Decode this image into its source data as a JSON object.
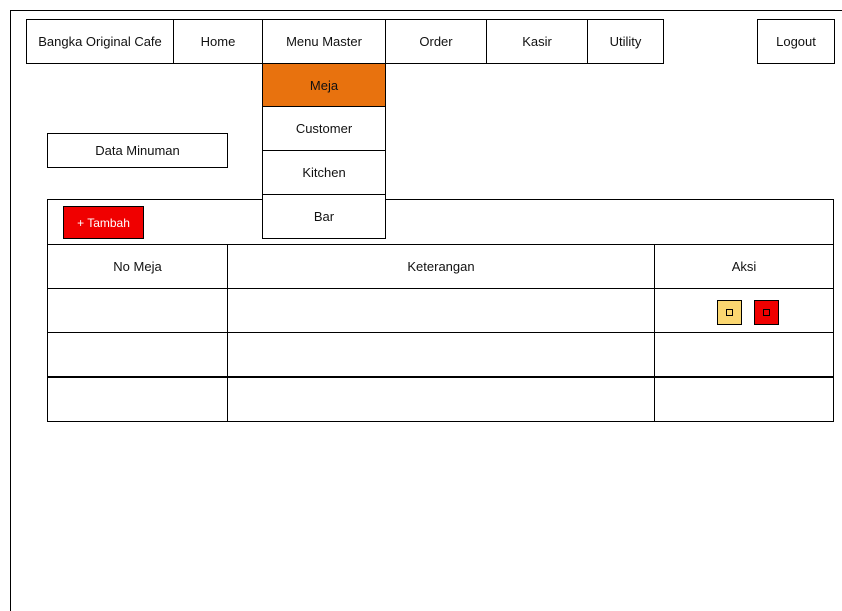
{
  "nav": {
    "brand": "Bangka Original Cafe",
    "items": [
      "Home",
      "Menu Master",
      "Order",
      "Kasir",
      "Utility"
    ],
    "logout": "Logout"
  },
  "dropdown": {
    "items": [
      "Meja",
      "Customer",
      "Kitchen",
      "Bar"
    ],
    "active": "Meja"
  },
  "section_title": "Data Minuman",
  "toolbar": {
    "add_label": "+ Tambah"
  },
  "table": {
    "headers": [
      "No Meja",
      "Keterangan",
      "Aksi"
    ],
    "rows": [
      {
        "no_meja": "",
        "keterangan": "",
        "has_actions": true
      },
      {
        "no_meja": "",
        "keterangan": "",
        "has_actions": false
      },
      {
        "no_meja": "",
        "keterangan": "",
        "has_actions": false
      }
    ]
  },
  "actions": {
    "edit_icon": "edit-icon",
    "delete_icon": "delete-icon"
  },
  "colors": {
    "active_menu": "#e8720e",
    "add_button": "#f00000",
    "edit_button": "#fbd770",
    "delete_button": "#f00000"
  }
}
